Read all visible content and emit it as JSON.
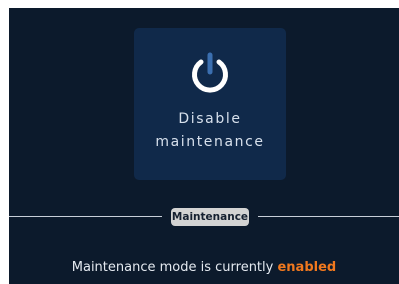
{
  "maintenance_toggle": {
    "label_line1": "Disable",
    "label_line2": "maintenance",
    "icon": "power-icon"
  },
  "divider": {
    "label": "Maintenance"
  },
  "status": {
    "prefix": "Maintenance mode is currently",
    "value": "enabled"
  },
  "colors": {
    "background": "#0c1a2c",
    "card": "#10294a",
    "power_icon": "#ffffff",
    "power_icon_stem": "#3b6fb0",
    "accent": "#f0781e"
  }
}
